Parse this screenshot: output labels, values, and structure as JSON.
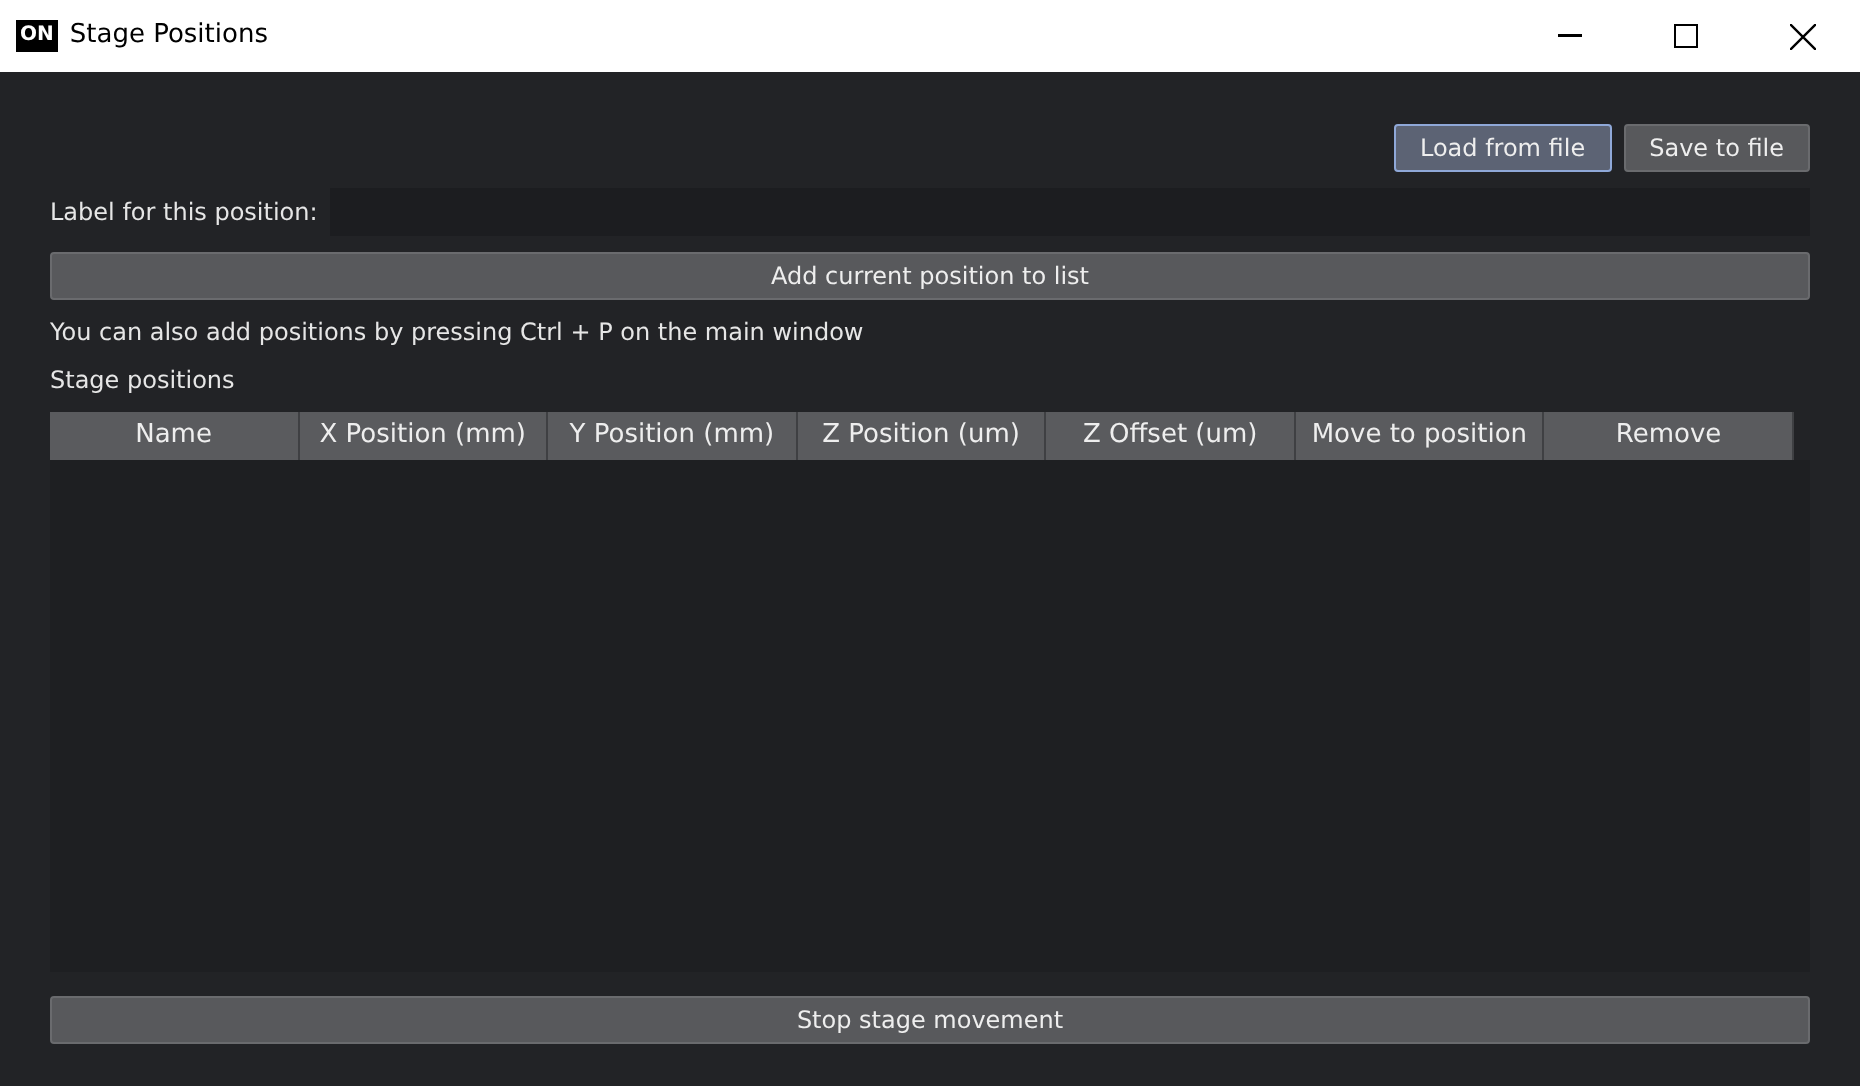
{
  "window": {
    "title": "Stage Positions",
    "logo": "ON"
  },
  "file_buttons": [
    {
      "label": "Load from file",
      "focused": true
    },
    {
      "label": "Save to file",
      "focused": false
    }
  ],
  "label_field": {
    "label": "Label for this position:"
  },
  "add_button": "Add current position to list",
  "hint": "You can also add positions by pressing Ctrl + P on the main window",
  "table": {
    "title": "Stage positions",
    "columns": [
      "Name",
      "X Position (mm)",
      "Y Position (mm)",
      "Z Position (um)",
      "Z Offset (um)",
      "Move to position",
      "Remove"
    ]
  },
  "stop_button": "Stop stage movement"
}
